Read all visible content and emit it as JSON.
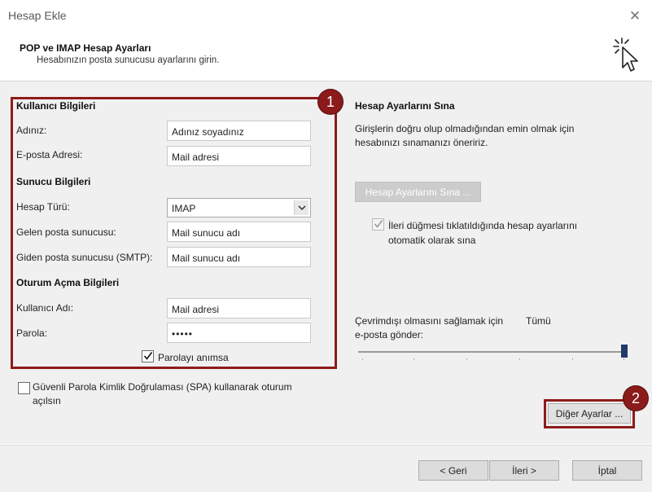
{
  "window": {
    "title": "Hesap Ekle"
  },
  "header": {
    "title": "POP ve IMAP Hesap Ayarları",
    "subtitle": "Hesabınızın posta sunucusu ayarlarını girin."
  },
  "user_info": {
    "heading": "Kullanıcı Bilgileri",
    "name_label": "Adınız:",
    "name_value": "Adınız soyadınız",
    "email_label": "E-posta Adresi:",
    "email_value": "Mail adresi"
  },
  "server_info": {
    "heading": "Sunucu Bilgileri",
    "account_type_label": "Hesap Türü:",
    "account_type_value": "IMAP",
    "incoming_label": "Gelen posta sunucusu:",
    "incoming_value": "Mail sunucu adı",
    "outgoing_label": "Giden posta sunucusu (SMTP):",
    "outgoing_value": "Mail sunucu adı"
  },
  "logon_info": {
    "heading": "Oturum Açma Bilgileri",
    "username_label": "Kullanıcı Adı:",
    "username_value": "Mail adresi",
    "password_label": "Parola:",
    "password_value": "•••••",
    "remember_label": "Parolayı anımsa",
    "remember_checked": true
  },
  "spa": {
    "label_line1": "Güvenli Parola Kimlik Doğrulaması (SPA) kullanarak oturum",
    "label_line2": "açılsın",
    "checked": false
  },
  "test_settings": {
    "heading": "Hesap Ayarlarını Sına",
    "desc_line1": "Girişlerin doğru olup olmadığından emin olmak için",
    "desc_line2": "hesabınızı sınamanızı öneririz.",
    "test_button": "Hesap Ayarlarını Sına ...",
    "auto_test_line1": "İleri düğmesi tıklatıldığında hesap ayarlarını",
    "auto_test_line2": "otomatik olarak sına",
    "auto_test_checked": true
  },
  "offline": {
    "label_line1": "Çevrimdışı olmasını sağlamak için",
    "label_line2": "e-posta gönder:",
    "value": "Tümü",
    "slider_position": 1.0
  },
  "more_settings_button": "Diğer Ayarlar ...",
  "footer": {
    "back": "< Geri",
    "next": "İleri >",
    "cancel": "İptal"
  },
  "annotations": {
    "badge1": "1",
    "badge2": "2"
  },
  "colors": {
    "highlight": "#8e1b1b",
    "badge": "#8b1a1a",
    "slider_thumb": "#1f3a6b"
  }
}
